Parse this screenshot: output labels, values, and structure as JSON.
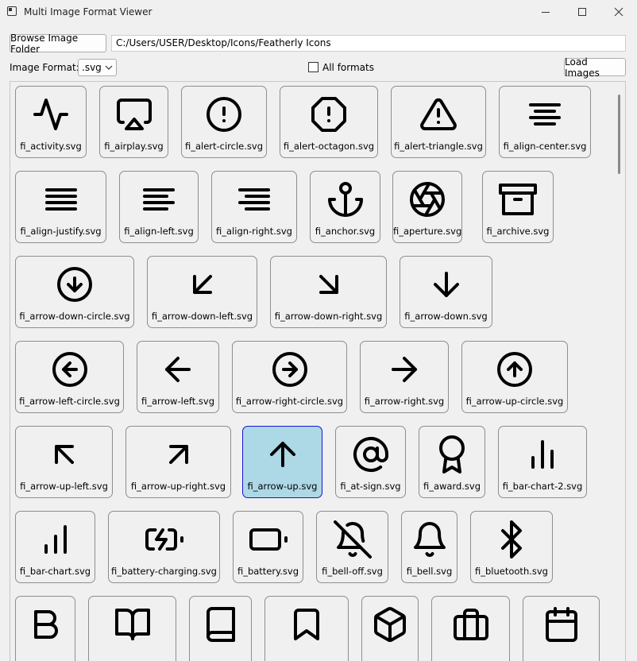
{
  "window": {
    "title": "Multi Image Format Viewer"
  },
  "toolbar": {
    "browse_label": "Browse Image Folder",
    "folder_path": "C:/Users/USER/Desktop/Icons/Featherly Icons",
    "format_label": "Image Format:",
    "format_value": ".svg",
    "all_formats_label": "All formats",
    "all_formats_checked": false,
    "load_label": "Load Images"
  },
  "accent": {
    "selected_bg": "#add8e6",
    "selected_border": "#1515d6"
  },
  "gallery": {
    "selected": "fi_arrow-up.svg",
    "items": [
      {
        "name": "fi_activity.svg",
        "icon": "activity-icon"
      },
      {
        "name": "fi_airplay.svg",
        "icon": "airplay-icon"
      },
      {
        "name": "fi_alert-circle.svg",
        "icon": "alert-circle-icon"
      },
      {
        "name": "fi_alert-octagon.svg",
        "icon": "alert-octagon-icon"
      },
      {
        "name": "fi_alert-triangle.svg",
        "icon": "alert-triangle-icon"
      },
      {
        "name": "fi_align-center.svg",
        "icon": "align-center-icon"
      },
      {
        "name": "fi_align-justify.svg",
        "icon": "align-justify-icon"
      },
      {
        "name": "fi_align-left.svg",
        "icon": "align-left-icon"
      },
      {
        "name": "fi_align-right.svg",
        "icon": "align-right-icon"
      },
      {
        "name": "fi_anchor.svg",
        "icon": "anchor-icon"
      },
      {
        "name": "fi_aperture.svg",
        "icon": "aperture-icon"
      },
      {
        "name": "fi_archive.svg",
        "icon": "archive-icon"
      },
      {
        "name": "fi_arrow-down-circle.svg",
        "icon": "arrow-down-circle-icon"
      },
      {
        "name": "fi_arrow-down-left.svg",
        "icon": "arrow-down-left-icon"
      },
      {
        "name": "fi_arrow-down-right.svg",
        "icon": "arrow-down-right-icon"
      },
      {
        "name": "fi_arrow-down.svg",
        "icon": "arrow-down-icon"
      },
      {
        "name": "fi_arrow-left-circle.svg",
        "icon": "arrow-left-circle-icon"
      },
      {
        "name": "fi_arrow-left.svg",
        "icon": "arrow-left-icon"
      },
      {
        "name": "fi_arrow-right-circle.svg",
        "icon": "arrow-right-circle-icon"
      },
      {
        "name": "fi_arrow-right.svg",
        "icon": "arrow-right-icon"
      },
      {
        "name": "fi_arrow-up-circle.svg",
        "icon": "arrow-up-circle-icon"
      },
      {
        "name": "fi_arrow-up-left.svg",
        "icon": "arrow-up-left-icon"
      },
      {
        "name": "fi_arrow-up-right.svg",
        "icon": "arrow-up-right-icon"
      },
      {
        "name": "fi_arrow-up.svg",
        "icon": "arrow-up-icon"
      },
      {
        "name": "fi_at-sign.svg",
        "icon": "at-sign-icon"
      },
      {
        "name": "fi_award.svg",
        "icon": "award-icon"
      },
      {
        "name": "fi_bar-chart-2.svg",
        "icon": "bar-chart-2-icon"
      },
      {
        "name": "fi_bar-chart.svg",
        "icon": "bar-chart-icon"
      },
      {
        "name": "fi_battery-charging.svg",
        "icon": "battery-charging-icon"
      },
      {
        "name": "fi_battery.svg",
        "icon": "battery-icon"
      },
      {
        "name": "fi_bell-off.svg",
        "icon": "bell-off-icon"
      },
      {
        "name": "fi_bell.svg",
        "icon": "bell-icon"
      },
      {
        "name": "fi_bluetooth.svg",
        "icon": "bluetooth-icon"
      },
      {
        "name": "",
        "icon": "bold-icon"
      },
      {
        "name": "",
        "icon": "book-open-icon"
      },
      {
        "name": "",
        "icon": "book-icon"
      },
      {
        "name": "",
        "icon": "bookmark-icon"
      },
      {
        "name": "",
        "icon": "box-icon"
      },
      {
        "name": "",
        "icon": "briefcase-icon"
      },
      {
        "name": "",
        "icon": "calendar-icon"
      }
    ]
  }
}
